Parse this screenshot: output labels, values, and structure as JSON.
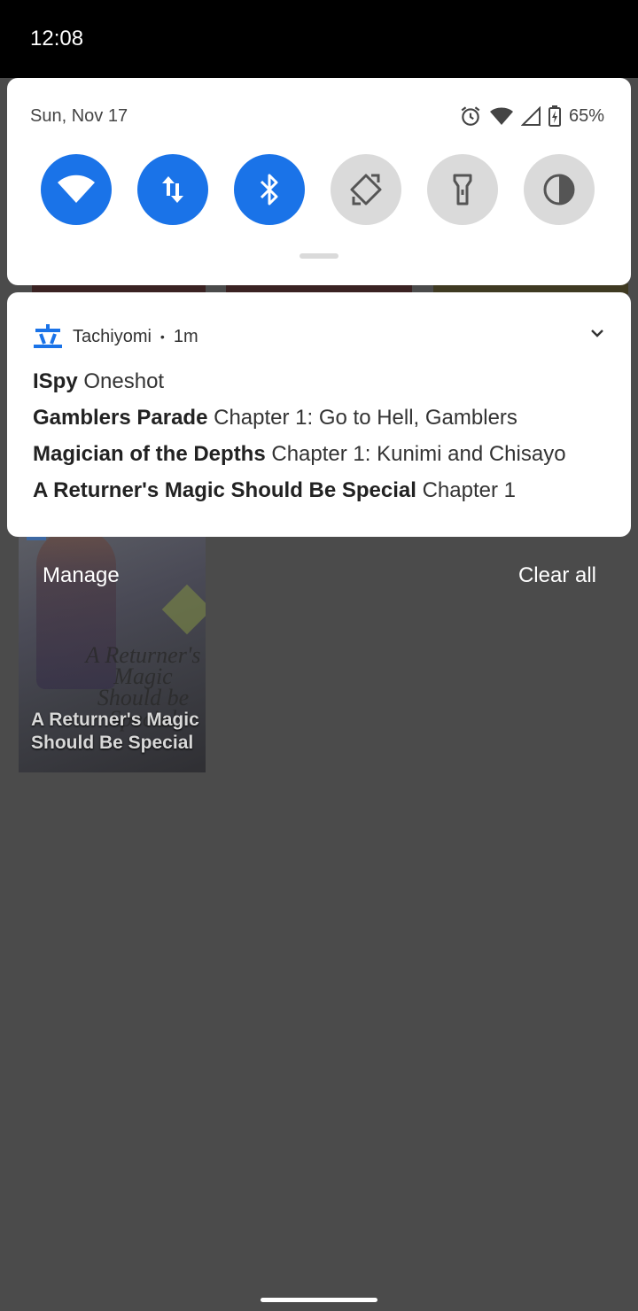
{
  "status_bar": {
    "time": "12:08"
  },
  "quick_settings": {
    "date": "Sun, Nov 17",
    "battery": "65%",
    "tiles": [
      {
        "name": "wifi",
        "icon": "wifi-icon",
        "state": "on"
      },
      {
        "name": "mobile-data",
        "icon": "data-arrows-icon",
        "state": "on"
      },
      {
        "name": "bluetooth",
        "icon": "bluetooth-icon",
        "state": "on"
      },
      {
        "name": "auto-rotate",
        "icon": "rotate-icon",
        "state": "off"
      },
      {
        "name": "flashlight",
        "icon": "flashlight-icon",
        "state": "off"
      },
      {
        "name": "invert-colors",
        "icon": "contrast-icon",
        "state": "off"
      }
    ]
  },
  "notification": {
    "app_name": "Tachiyomi",
    "time_ago": "1m",
    "app_icon": "tachiyomi-icon",
    "lines": [
      {
        "title": "ISpy",
        "detail": "Oneshot"
      },
      {
        "title": "Gamblers Parade",
        "detail": "Chapter 1: Go to Hell, Gamblers"
      },
      {
        "title": "Magician of the Depths",
        "detail": "Chapter 1: Kunimi and Chisayo"
      },
      {
        "title": "A Returner's Magic Should Be Special",
        "detail": "Chapter 1"
      }
    ]
  },
  "footer": {
    "manage": "Manage",
    "clear_all": "Clear all"
  },
  "background": {
    "cover_art_text": "A Returner's Magic Should be Special",
    "cover_title": "A Returner's Magic Should Be Special"
  },
  "colors": {
    "accent": "#1a73e8",
    "tile_off": "#dadada",
    "scrim": "#4a4a4a"
  }
}
